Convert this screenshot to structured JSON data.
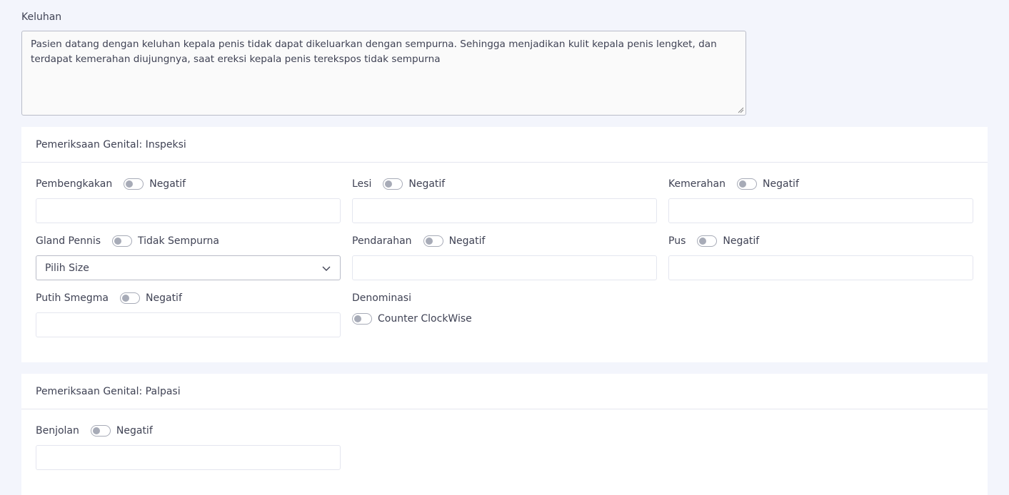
{
  "keluhan": {
    "label": "Keluhan",
    "value": "Pasien datang dengan keluhan kepala penis tidak dapat dikeluarkan dengan sempurna. Sehingga menjadikan kulit kepala penis lengket, dan terdapat kemerahan diujungnya, saat ereksi kepala penis terekspos tidak sempurna"
  },
  "inspeksi": {
    "title": "Pemeriksaan Genital: Inspeksi",
    "pembengkakan": {
      "label": "Pembengkakan",
      "status": "Negatif"
    },
    "lesi": {
      "label": "Lesi",
      "status": "Negatif"
    },
    "kemerahan": {
      "label": "Kemerahan",
      "status": "Negatif"
    },
    "gland_pennis": {
      "label": "Gland Pennis",
      "status": "Tidak Sempurna",
      "select_value": "Pilih Size"
    },
    "pendarahan": {
      "label": "Pendarahan",
      "status": "Negatif"
    },
    "pus": {
      "label": "Pus",
      "status": "Negatif"
    },
    "putih_smegma": {
      "label": "Putih Smegma",
      "status": "Negatif"
    },
    "denominasi": {
      "label": "Denominasi",
      "status": "Counter ClockWise"
    }
  },
  "palpasi": {
    "title": "Pemeriksaan Genital: Palpasi",
    "benjolan": {
      "label": "Benjolan",
      "status": "Negatif"
    }
  },
  "colors": {
    "background": "#f3f5fc",
    "card": "#ffffff",
    "text": "#3f4254",
    "toggle_off": "#a7abb7"
  }
}
